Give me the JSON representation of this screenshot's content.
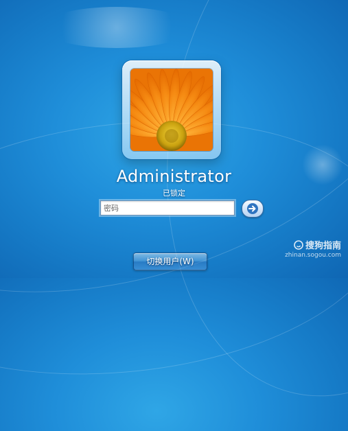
{
  "user": {
    "name": "Administrator",
    "status": "已锁定",
    "avatar_icon": "orange-gerbera-flower"
  },
  "password": {
    "placeholder": "密码",
    "value": ""
  },
  "submit": {
    "icon": "arrow-right-icon"
  },
  "switch_user": {
    "label": "切换用户(W)"
  },
  "watermark": {
    "brand": "搜狗指南",
    "url": "zhinan.sogou.com"
  },
  "colors": {
    "background": "#1f8ed9",
    "flower": "#f07f0b",
    "flower_center": "#c9a10f"
  }
}
